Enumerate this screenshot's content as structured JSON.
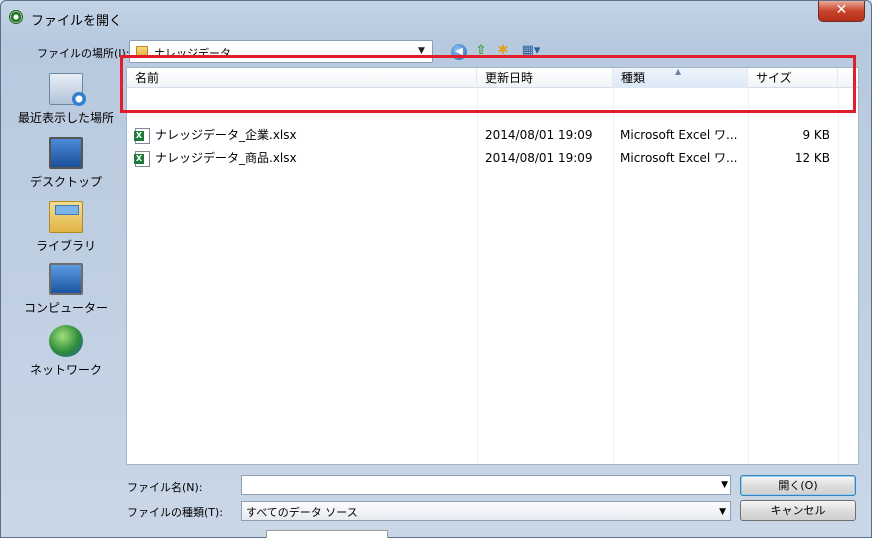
{
  "window": {
    "title": "ファイルを開く",
    "close_glyph": "✕"
  },
  "toolbar": {
    "look_in_label": "ファイルの場所(I):",
    "look_in_value": "ナレッジデータ",
    "dropdown_glyph": "▼",
    "back_glyph": "◀",
    "up_glyph": "⇧",
    "newfolder_glyph": "✱",
    "view_glyph": "▦▾"
  },
  "places": [
    {
      "label": "最近表示した場所",
      "icon": "recent-places-icon"
    },
    {
      "label": "デスクトップ",
      "icon": "desktop-icon"
    },
    {
      "label": "ライブラリ",
      "icon": "library-icon"
    },
    {
      "label": "コンピューター",
      "icon": "computer-icon"
    },
    {
      "label": "ネットワーク",
      "icon": "network-icon"
    }
  ],
  "columns": {
    "name": "名前",
    "modified": "更新日時",
    "type": "種類",
    "size": "サイズ",
    "sort_glyph": "▲"
  },
  "files": [
    {
      "name": "ナレッジデータ_企業.xlsx",
      "modified": "2014/08/01 19:09",
      "type": "Microsoft Excel ワ...",
      "size": "9 KB"
    },
    {
      "name": "ナレッジデータ_商品.xlsx",
      "modified": "2014/08/01 19:09",
      "type": "Microsoft Excel ワ...",
      "size": "12 KB"
    }
  ],
  "footer": {
    "filename_label": "ファイル名(N):",
    "filename_value": "",
    "filetype_label": "ファイルの種類(T):",
    "filetype_value": "すべてのデータ ソース",
    "open_button": "開く(O)",
    "cancel_button": "キャンセル"
  },
  "colors": {
    "highlight": "#e21d2c",
    "titlebar": "#c4d4e6",
    "close": "#c7432b"
  }
}
